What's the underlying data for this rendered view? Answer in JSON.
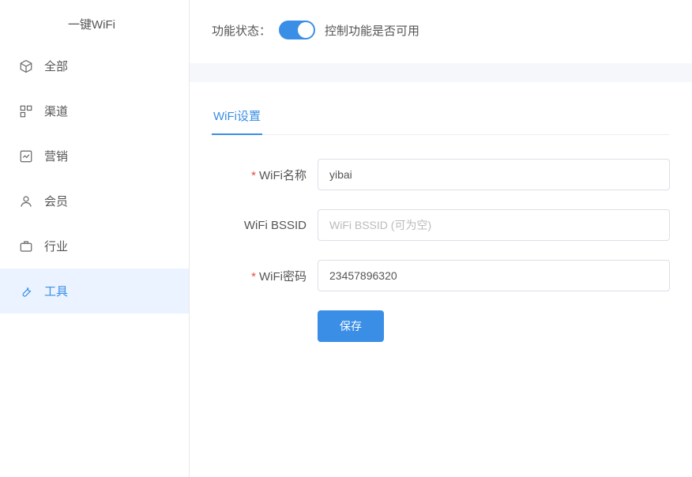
{
  "sidebar": {
    "sub_item": "一键WiFi",
    "items": [
      {
        "label": "全部"
      },
      {
        "label": "渠道"
      },
      {
        "label": "营销"
      },
      {
        "label": "会员"
      },
      {
        "label": "行业"
      },
      {
        "label": "工具"
      }
    ]
  },
  "top": {
    "func_label": "功能状态：",
    "func_desc": "控制功能是否可用"
  },
  "form": {
    "tab": "WiFi设置",
    "wifi_name_label": "WiFi名称",
    "wifi_name_value": "yibai",
    "bssid_label": "WiFi BSSID",
    "bssid_value": "",
    "bssid_placeholder": "WiFi BSSID (可为空)",
    "password_label": "WiFi密码",
    "password_value": "23457896320",
    "save_label": "保存"
  }
}
